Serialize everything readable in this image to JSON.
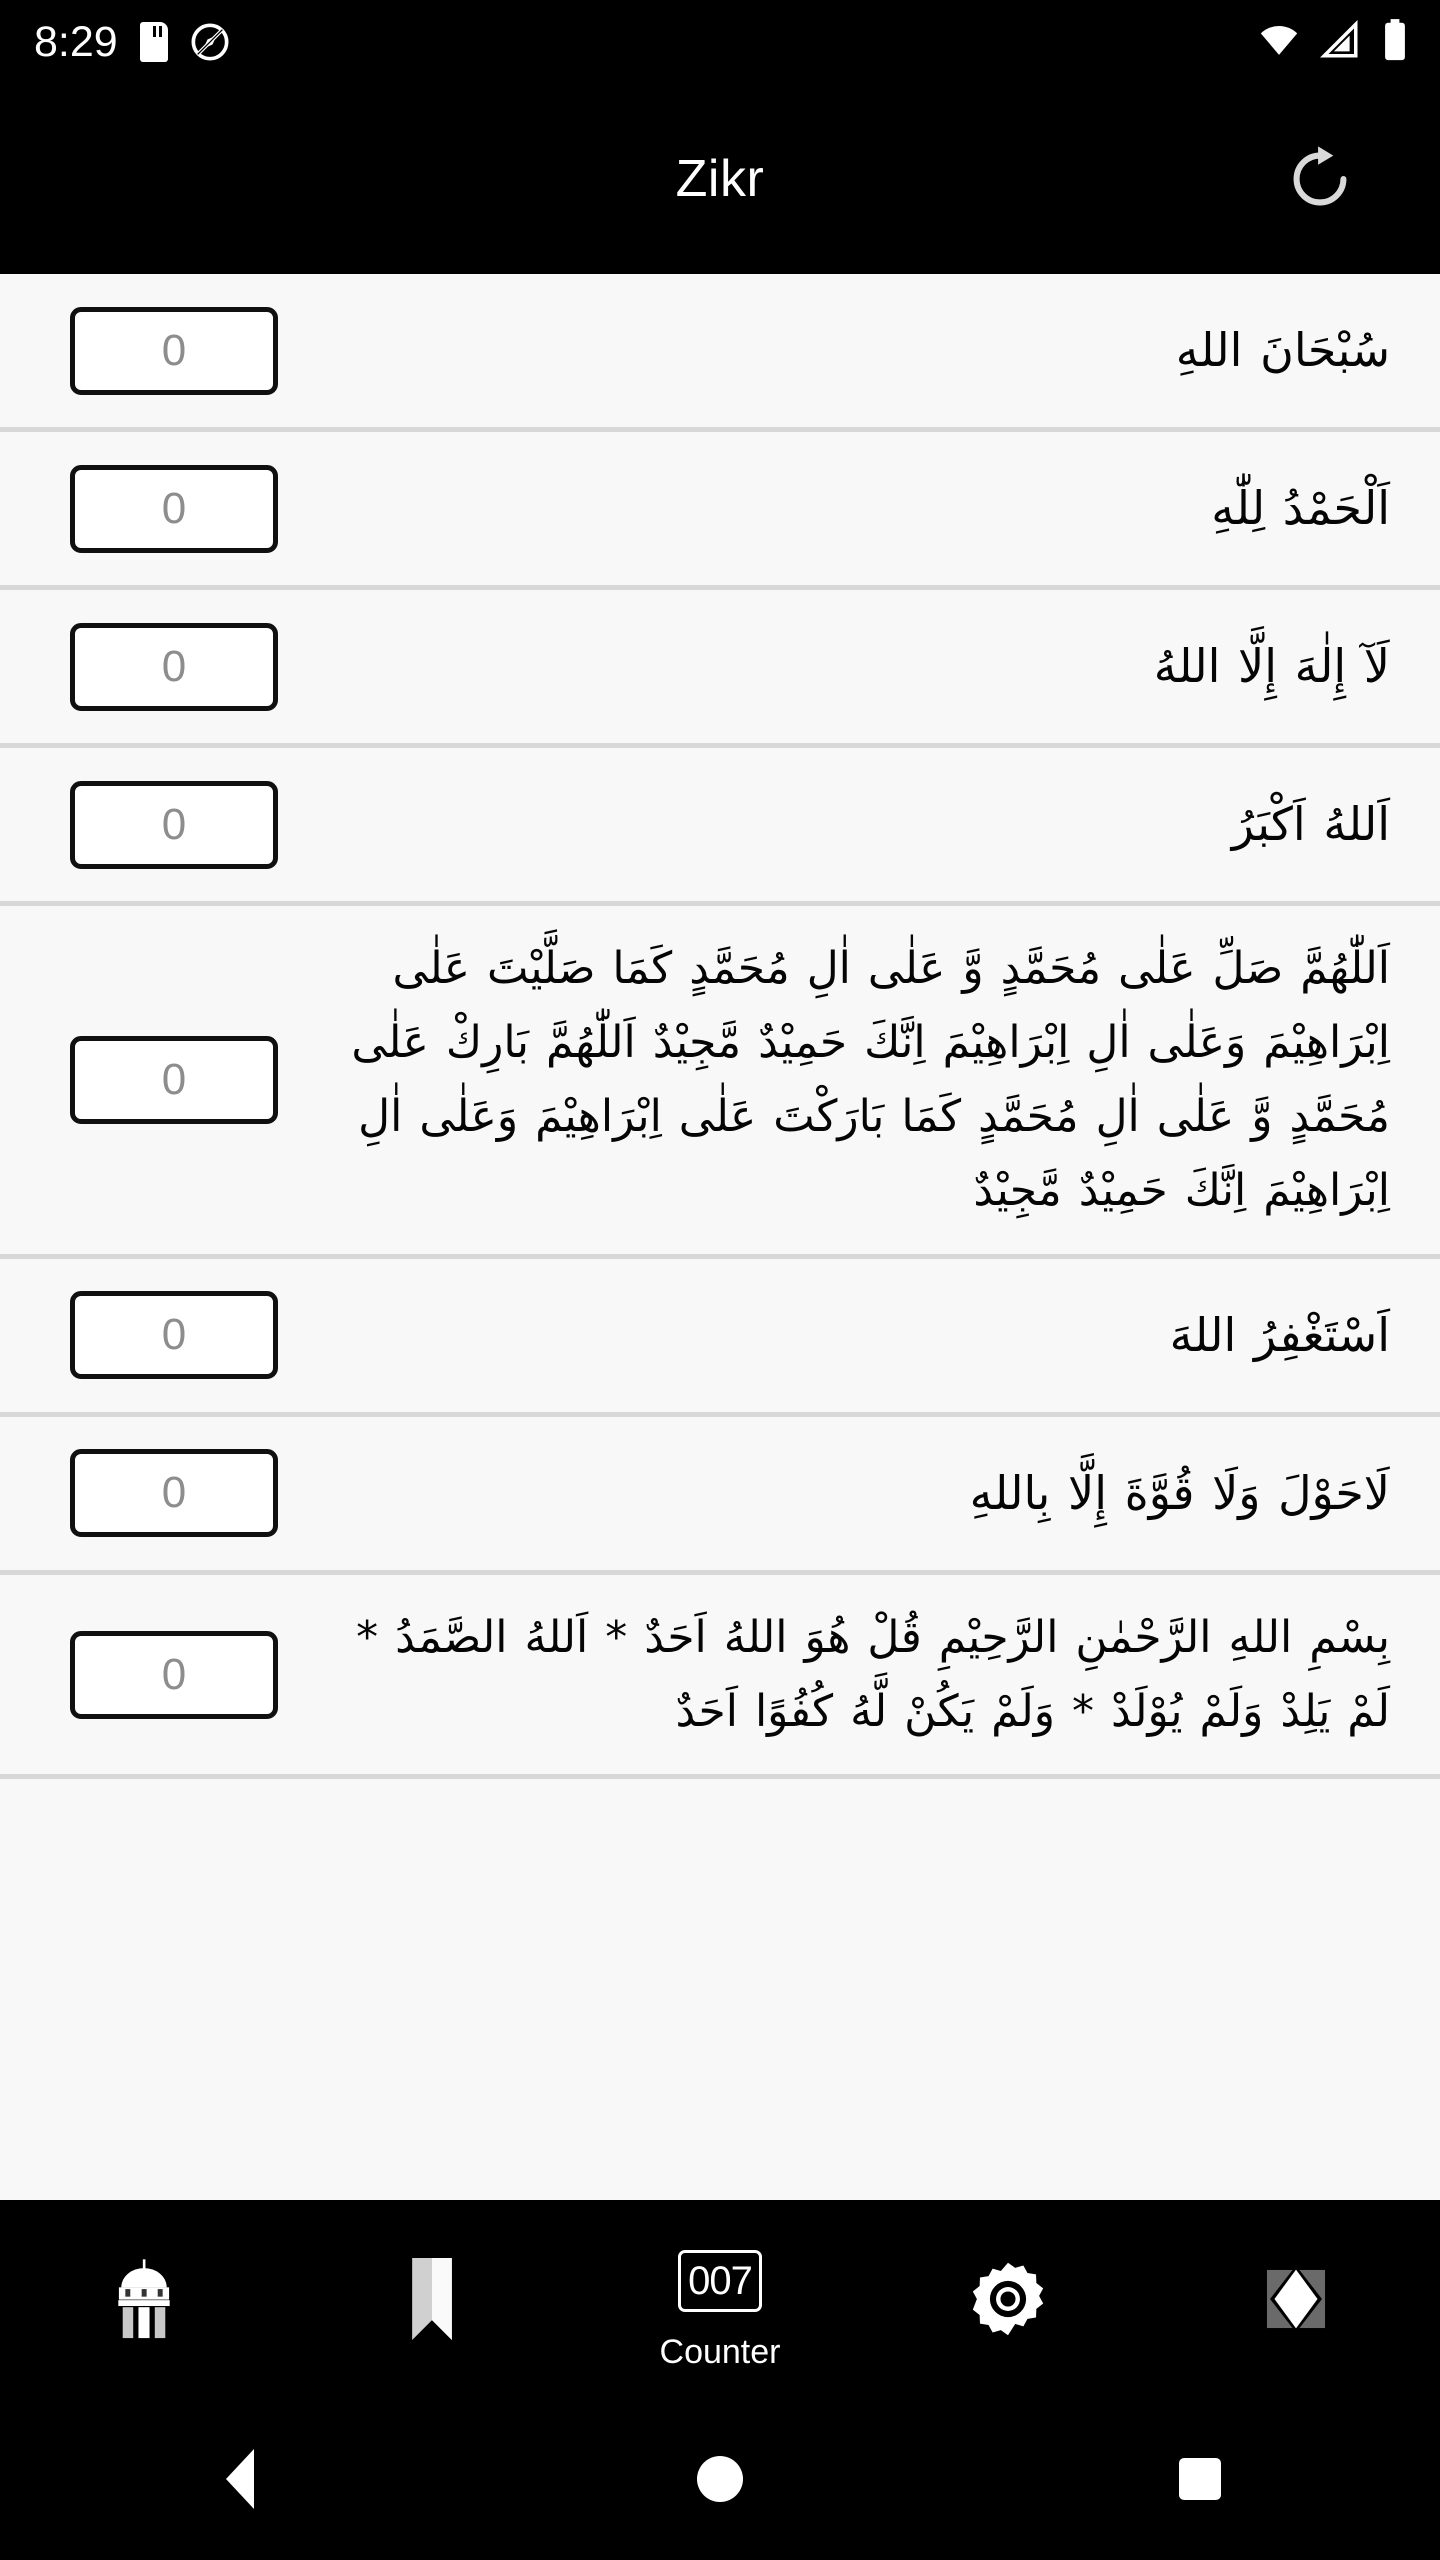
{
  "status_bar": {
    "time": "8:29",
    "icons": [
      "sd-card-icon",
      "location-off-icon",
      "wifi-icon",
      "cellular-signal-icon",
      "battery-icon"
    ]
  },
  "app_bar": {
    "title": "Zikr",
    "refresh_label": "refresh-icon"
  },
  "zikr_list": {
    "rows": [
      {
        "counter": "0",
        "text": "سُبْحَانَ اللهِ"
      },
      {
        "counter": "0",
        "text": "اَلْحَمْدُ لِلّٰهِ"
      },
      {
        "counter": "0",
        "text": "لَآ إِلٰهَ إِلَّا اللهُ"
      },
      {
        "counter": "0",
        "text": "اَللهُ اَكْبَرُ"
      },
      {
        "counter": "0",
        "text": "اَللّٰهُمَّ صَلِّ عَلٰى مُحَمَّدٍ وَّ عَلٰى اٰلِ مُحَمَّدٍ كَمَا صَلَّيْتَ عَلٰى اِبْرَاهِيْمَ وَعَلٰى اٰلِ اِبْرَاهِيْمَ اِنَّكَ حَمِيْدٌ مَّجِيْدٌ اَللّٰهُمَّ بَارِكْ عَلٰى مُحَمَّدٍ وَّ عَلٰى اٰلِ مُحَمَّدٍ كَمَا بَارَكْتَ عَلٰى اِبْرَاهِيْمَ وَعَلٰى اٰلِ اِبْرَاهِيْمَ اِنَّكَ حَمِيْدٌ مَّجِيْدٌ"
      },
      {
        "counter": "0",
        "text": "اَسْتَغْفِرُ اللهَ"
      },
      {
        "counter": "0",
        "text": "لَاحَوْلَ وَلَا قُوَّةَ إِلَّا بِاللهِ"
      },
      {
        "counter": "0",
        "text": "بِسْمِ اللهِ الرَّحْمٰنِ الرَّحِيْمِ قُلْ هُوَ اللهُ اَحَدٌ * اَللهُ الصَّمَدُ * لَمْ يَلِدْ وَلَمْ يُوْلَدْ * وَلَمْ يَكُنْ لَّهُ كُفُوًا اَحَدٌ"
      }
    ]
  },
  "bottom_nav": {
    "items": [
      {
        "icon": "mosque-icon",
        "label": ""
      },
      {
        "icon": "bookmark-icon",
        "label": ""
      },
      {
        "icon": "counter-icon",
        "label": "Counter",
        "icon_text": "007",
        "selected": true
      },
      {
        "icon": "settings-gear-icon",
        "label": ""
      },
      {
        "icon": "theme-diamond-icon",
        "label": ""
      }
    ]
  },
  "android_nav": {
    "back": "back-button",
    "home": "home-button",
    "recents": "recents-button"
  },
  "colors": {
    "bar_background": "#000000",
    "list_background": "#f8f8f8",
    "divider": "#d8d8d8",
    "counter_text": "#8d8d8d",
    "text": "#050505"
  }
}
